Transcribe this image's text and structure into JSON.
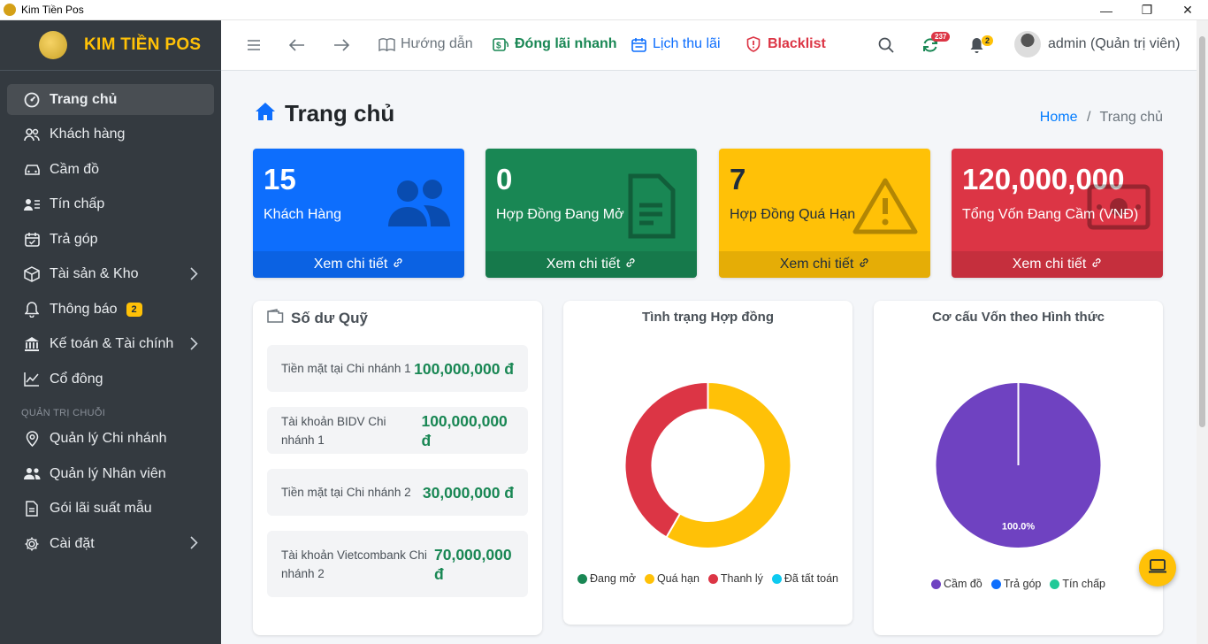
{
  "window": {
    "title": "Kim Tiền Pos",
    "minimize": "—",
    "restore": "❐",
    "close": "✕"
  },
  "brand": {
    "name": "KIM TIỀN POS"
  },
  "sidebar": {
    "items": [
      {
        "label": "Trang chủ",
        "icon": "dashboard-icon",
        "active": true
      },
      {
        "label": "Khách hàng",
        "icon": "users-icon"
      },
      {
        "label": "Cầm đồ",
        "icon": "car-icon"
      },
      {
        "label": "Tín chấp",
        "icon": "id-card-icon"
      },
      {
        "label": "Trả góp",
        "icon": "calendar-check-icon"
      },
      {
        "label": "Tài sản & Kho",
        "icon": "box-icon",
        "has_children": true
      },
      {
        "label": "Thông báo",
        "icon": "bell-icon",
        "badge": "2"
      },
      {
        "label": "Kế toán & Tài chính",
        "icon": "bank-icon",
        "has_children": true
      },
      {
        "label": "Cổ đông",
        "icon": "chart-line-icon"
      }
    ],
    "section_header": "QUẢN TRỊ CHUỖI",
    "admin_items": [
      {
        "label": "Quản lý Chi nhánh",
        "icon": "map-pin-icon"
      },
      {
        "label": "Quản lý Nhân viên",
        "icon": "people-icon"
      },
      {
        "label": "Gói lãi suất mẫu",
        "icon": "file-icon"
      },
      {
        "label": "Cài đặt",
        "icon": "gear-icon",
        "has_children": true
      }
    ]
  },
  "topbar": {
    "guide": "Hướng dẫn",
    "quick_pay": "Đóng lãi nhanh",
    "schedule": "Lịch thu lãi",
    "blacklist": "Blacklist",
    "sync_badge": "237",
    "notif_badge": "2",
    "user": "admin (Quản trị viên)",
    "colors": {
      "green": "#198754",
      "blue": "#0d6efd",
      "red": "#dc3545"
    }
  },
  "page": {
    "title": "Trang chủ",
    "breadcrumb_home": "Home",
    "breadcrumb_sep": "/",
    "breadcrumb_current": "Trang chủ"
  },
  "stats": [
    {
      "value": "15",
      "label": "Khách Hàng",
      "footer": "Xem chi tiết",
      "color": "#0d6efd",
      "icon": "users-icon"
    },
    {
      "value": "0",
      "label": "Hợp Đồng Đang Mở",
      "footer": "Xem chi tiết",
      "color": "#198754",
      "icon": "document-icon"
    },
    {
      "value": "7",
      "label": "Hợp Đồng Quá Hạn",
      "footer": "Xem chi tiết",
      "color": "#ffc107",
      "icon": "warning-icon"
    },
    {
      "value": "120,000,000",
      "label": "Tổng Vốn Đang Cầm (VNĐ)",
      "footer": "Xem chi tiết",
      "color": "#dc3545",
      "icon": "money-icon"
    }
  ],
  "funds": {
    "title": "Số dư Quỹ",
    "rows": [
      {
        "label": "Tiền mặt tại Chi nhánh 1",
        "value": "100,000,000 đ"
      },
      {
        "label": "Tài khoản BIDV Chi nhánh 1",
        "value": "100,000,000 đ"
      },
      {
        "label": "Tiền mặt tại Chi nhánh 2",
        "value": "30,000,000 đ"
      },
      {
        "label": "Tài khoản Vietcombank Chi nhánh 2",
        "value": "70,000,000 đ"
      }
    ]
  },
  "chart_data": [
    {
      "type": "pie",
      "variant": "doughnut",
      "title": "Tình trạng Hợp đồng",
      "categories": [
        "Đang mở",
        "Quá hạn",
        "Thanh lý",
        "Đã tất toán"
      ],
      "values": [
        0,
        7,
        5,
        0
      ],
      "colors": [
        "#198754",
        "#ffc107",
        "#dc3545",
        "#0dcaf0"
      ],
      "legend": "bottom"
    },
    {
      "type": "pie",
      "title": "Cơ cấu Vốn theo Hình thức",
      "categories": [
        "Cầm đồ",
        "Trả góp",
        "Tín chấp"
      ],
      "values": [
        100,
        0,
        0
      ],
      "colors": [
        "#6f42c1",
        "#0d6efd",
        "#20c997"
      ],
      "data_labels": [
        "100.0%"
      ],
      "legend": "bottom"
    }
  ]
}
